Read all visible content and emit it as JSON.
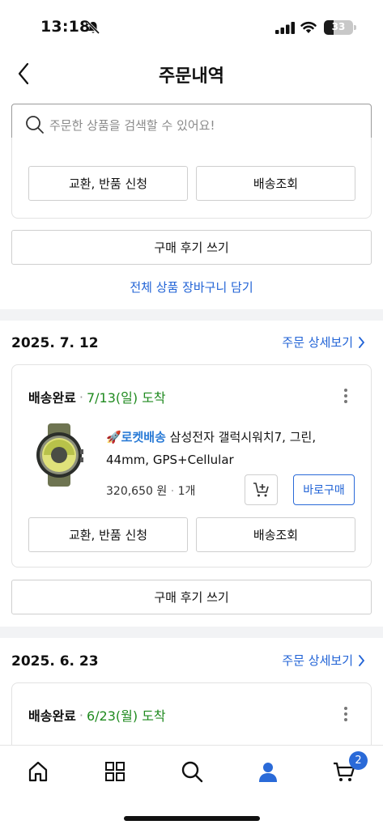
{
  "status_bar": {
    "time": "13:18",
    "battery": "33",
    "battery_level": 0.33
  },
  "header": {
    "title": "주문내역"
  },
  "search": {
    "placeholder": "주문한 상품을 검색할 수 있어요!"
  },
  "previous_order": {
    "exchange_button": "교환, 반품 신청",
    "tracking_button": "배송조회",
    "review_button": "구매 후기 쓰기",
    "add_all_to_cart": "전체 상품 장바구니 담기"
  },
  "orders": [
    {
      "date": "2025. 7. 12",
      "detail_link": "주문 상세보기",
      "status": "배송완료",
      "separator": "·",
      "arrival": "7/13(일) 도착",
      "rocket_label": "🚀로켓배송",
      "product_name": "삼성전자 갤럭시워치7, 그린, 44mm, GPS+Cellular",
      "price": "320,650 원",
      "quantity": "1개",
      "buy_now": "바로구매",
      "exchange_button": "교환, 반품 신청",
      "tracking_button": "배송조회",
      "review_button": "구매 후기 쓰기"
    },
    {
      "date": "2025. 6. 23",
      "detail_link": "주문 상세보기",
      "status": "배송완료",
      "separator": "·",
      "arrival": "6/23(월) 도착"
    }
  ],
  "tab_bar": {
    "items": [
      "home-icon",
      "categories-icon",
      "search-icon",
      "my-page-icon",
      "cart-icon"
    ],
    "cart_badge": "2",
    "accent_color": "#2a6ad8"
  },
  "colors": {
    "link": "#2163d6",
    "arrival_green": "#1f8a1f",
    "accent": "#2a6ad8"
  }
}
